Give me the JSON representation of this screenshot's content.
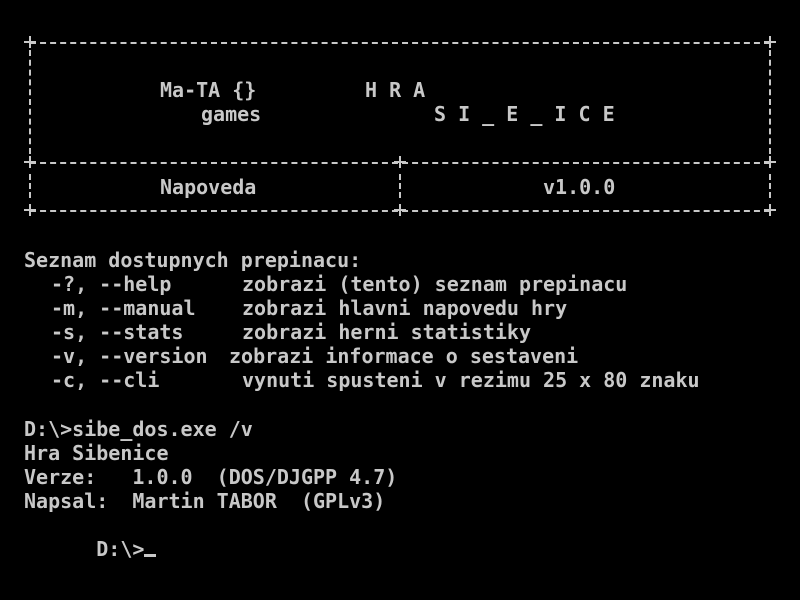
{
  "banner": {
    "logo_line1": "Ma-TA {}",
    "logo_line2": "games",
    "title_line1": "H R A",
    "title_line2": "S I _ E _ I C E",
    "help_label": "Napoveda",
    "version": "v1.0.0"
  },
  "help": {
    "heading": "Seznam dostupnych prepinacu:",
    "options": [
      {
        "switch": "-?, --help",
        "desc": "zobrazi (tento) seznam prepinacu"
      },
      {
        "switch": "-m, --manual",
        "desc": "zobrazi hlavni napovedu hry"
      },
      {
        "switch": "-s, --stats",
        "desc": "zobrazi herni statistiky"
      },
      {
        "switch": "-v, --version",
        "desc": "zobrazi informace o sestaveni"
      },
      {
        "switch": "-c, --cli",
        "desc": "vynuti spusteni v rezimu 25 x 80 znaku"
      }
    ]
  },
  "session": {
    "command_line": "D:\\>sibe_dos.exe /v",
    "out_name": "Hra Sibenice",
    "out_version": "Verze:   1.0.0  (DOS/DJGPP 4.7)",
    "out_author": "Napsal:  Martin TABOR  (GPLv3)",
    "prompt": "D:\\>"
  },
  "colors": {
    "background": "#000000",
    "foreground": "#c8c8c8"
  }
}
